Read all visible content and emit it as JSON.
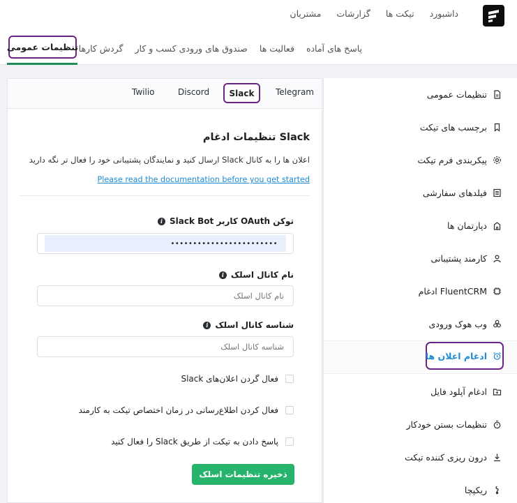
{
  "main_nav": [
    "داشبورد",
    "تیکت ها",
    "گزارشات",
    "مشتریان"
  ],
  "sub_nav": [
    "پاسخ های آماده",
    "فعالیت ها",
    "صندوق های ورودی کسب و کار",
    "گردش کارها"
  ],
  "active_subtab": "تنظیمات عمومی",
  "sidebar": {
    "items": [
      {
        "label": "تنظیمات عمومی",
        "icon": "document-icon"
      },
      {
        "label": "برچسب های تیکت",
        "icon": "bookmark-icon"
      },
      {
        "label": "پیکربندی فرم تیکت",
        "icon": "gear-icon"
      },
      {
        "label": "فیلدهای سفارشی",
        "icon": "list-icon"
      },
      {
        "label": "دپارتمان ها",
        "icon": "building-icon"
      },
      {
        "label": "کارمند پشتیبانی",
        "icon": "user-icon"
      },
      {
        "label": "ادغام FluentCRM",
        "icon": "chip-icon"
      },
      {
        "label": "وب هوک ورودی",
        "icon": "webhook-icon"
      },
      {
        "label": "ادغام اعلان ها",
        "icon": "alarm-icon"
      },
      {
        "label": "ادغام آپلود فایل",
        "icon": "folder-icon"
      },
      {
        "label": "تنظیمات بستن خودکار",
        "icon": "timer-icon"
      },
      {
        "label": "درون ریزی کننده تیکت",
        "icon": "download-icon"
      },
      {
        "label": "ریکپچا",
        "icon": "lock-icon"
      }
    ]
  },
  "tabs": {
    "telegram": "Telegram",
    "slack": "Slack",
    "discord": "Discord",
    "twilio": "Twilio"
  },
  "section": {
    "title": "Slack تنظیمات ادغام",
    "description": "اعلان ها را به کانال Slack ارسال کنید و نمایندگان پشتیبانی خود را فعال تر نگه دارید",
    "doc_link": "Please read the documentation before you get started"
  },
  "fields": {
    "token_label": "توکن OAuth کاربر Slack Bot",
    "token_value": "••••••••••••••••••••••••",
    "channel_name_label": "نام کانال اسلک",
    "channel_name_placeholder": "نام کانال اسلک",
    "channel_id_label": "شناسه کانال اسلک",
    "channel_id_placeholder": "شناسه کانال اسلک"
  },
  "checkboxes": [
    "فعال گردن اعلان‌های Slack",
    "فعال کردن اطلاع‌رسانی در زمان اختصاص تیکت به کارمند",
    "پاسخ دادن به تیکت از طریق Slack را فعال کنید"
  ],
  "save_button": "ذخیره تنظیمات اسلک",
  "colors": {
    "accent_purple": "#6a2486",
    "primary_green": "#26b36b",
    "link_blue": "#1d8bd6"
  }
}
